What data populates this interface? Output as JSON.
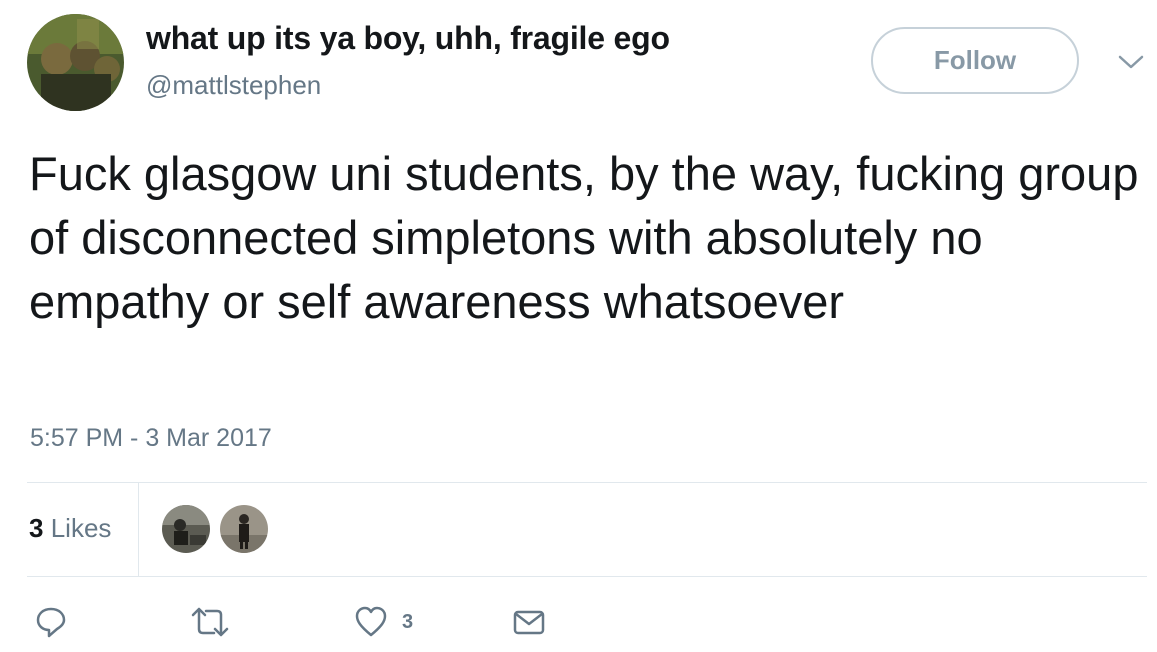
{
  "author": {
    "display_name": "what up its ya boy, uhh, fragile ego",
    "username": "@mattlstephen",
    "avatar": "profile-photo"
  },
  "header": {
    "follow_label": "Follow",
    "menu_icon": "chevron-down-icon"
  },
  "tweet": {
    "text": "Fuck glasgow uni students, by the way, fucking group of disconnected simpletons with absolutely no empathy or self awareness whatsoever",
    "timestamp": "5:57 PM - 3 Mar 2017"
  },
  "stats": {
    "likes_number": "3",
    "likes_label": "Likes",
    "likers": [
      "liker-avatar-1",
      "liker-avatar-2"
    ]
  },
  "actions": {
    "reply_icon": "reply-icon",
    "retweet_icon": "retweet-icon",
    "like_icon": "heart-icon",
    "like_count": "3",
    "dm_icon": "envelope-icon"
  },
  "colors": {
    "text": "#14171a",
    "secondary": "#657786",
    "follow_border": "#c6d1d9",
    "follow_text": "#8899a6",
    "divider": "#e1e8ed"
  }
}
